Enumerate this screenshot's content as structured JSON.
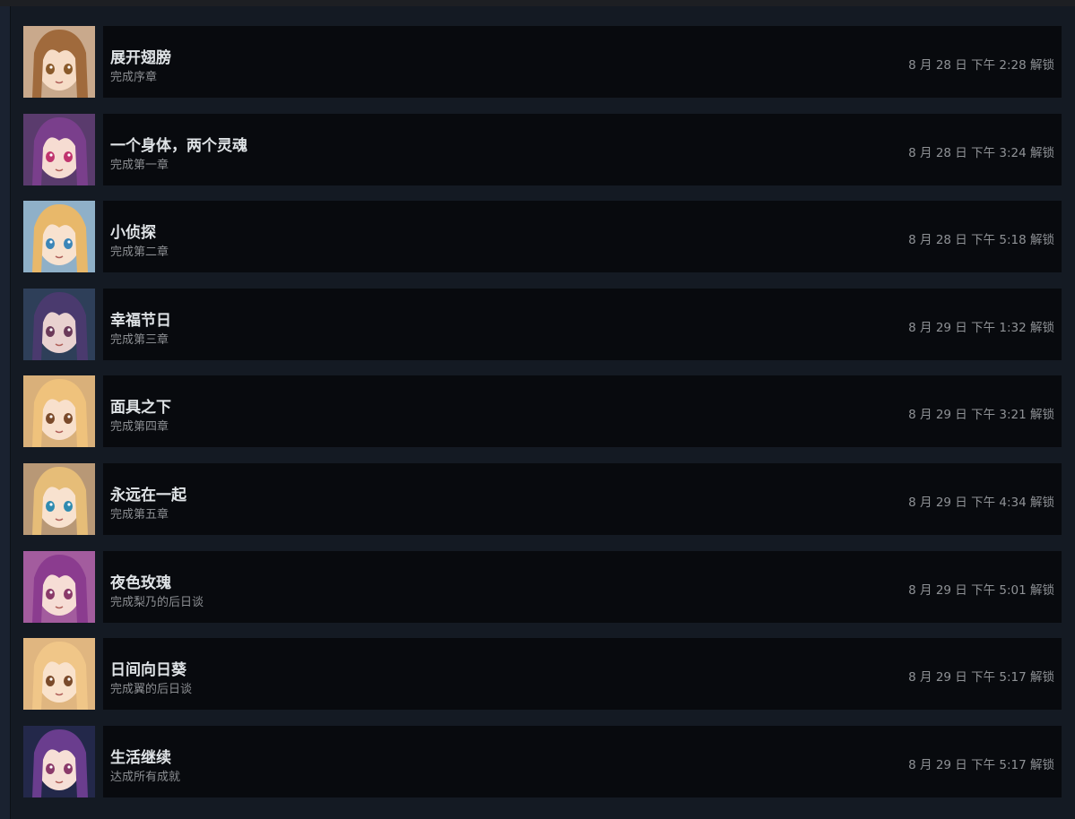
{
  "achievements": [
    {
      "title": "展开翅膀",
      "desc": "完成序章",
      "date": "8 月 28 日 下午 2:28 解锁",
      "icon": "character-brown-hair-icon",
      "bg": "#c9a98c",
      "hair": "#a06a3c",
      "skin": "#f6dcc6",
      "eye": "#8a5a2a"
    },
    {
      "title": "一个身体，两个灵魂",
      "desc": "完成第一章",
      "date": "8 月 28 日 下午 3:24 解锁",
      "icon": "character-purple-hair-icon",
      "bg": "#5a3b6d",
      "hair": "#7a3f8c",
      "skin": "#f6dcd2",
      "eye": "#c0346e"
    },
    {
      "title": "小侦探",
      "desc": "完成第二章",
      "date": "8 月 28 日 下午 5:18 解锁",
      "icon": "character-blonde-hair-icon",
      "bg": "#8fb0c8",
      "hair": "#e8b86a",
      "skin": "#f8e2cf",
      "eye": "#3c86b8"
    },
    {
      "title": "幸福节日",
      "desc": "完成第三章",
      "date": "8 月 29 日 下午 1:32 解锁",
      "icon": "character-dark-hair-icon",
      "bg": "#2e3f59",
      "hair": "#4a3a6e",
      "skin": "#e9d2d0",
      "eye": "#6b3a5a"
    },
    {
      "title": "面具之下",
      "desc": "完成第四章",
      "date": "8 月 29 日 下午 3:21 解锁",
      "icon": "character-blonde-smiling-icon",
      "bg": "#d9b07a",
      "hair": "#efc27c",
      "skin": "#f8e0cc",
      "eye": "#7a4a2a"
    },
    {
      "title": "永远在一起",
      "desc": "完成第五章",
      "date": "8 月 29 日 下午 4:34 解锁",
      "icon": "character-blonde-ribbon-icon",
      "bg": "#b89876",
      "hair": "#e6bd78",
      "skin": "#f8e2cf",
      "eye": "#2f8bb0"
    },
    {
      "title": "夜色玫瑰",
      "desc": "完成梨乃的后日谈",
      "date": "8 月 29 日 下午 5:01 解锁",
      "icon": "character-purple-teal-hair-icon",
      "bg": "#a35c9e",
      "hair": "#8b3c8f",
      "skin": "#f6ddd5",
      "eye": "#8a3a6a"
    },
    {
      "title": "日间向日葵",
      "desc": "完成翼的后日谈",
      "date": "8 月 29 日 下午 5:17 解锁",
      "icon": "character-blonde-happy-icon",
      "bg": "#e0b680",
      "hair": "#f0c688",
      "skin": "#f9e2cc",
      "eye": "#7a4a2a"
    },
    {
      "title": "生活继续",
      "desc": "达成所有成就",
      "date": "8 月 29 日 下午 5:17 解锁",
      "icon": "character-duo-icon",
      "bg": "#23284a",
      "hair": "#6a3d8e",
      "skin": "#f6dfd6",
      "eye": "#8a3a6a"
    }
  ]
}
